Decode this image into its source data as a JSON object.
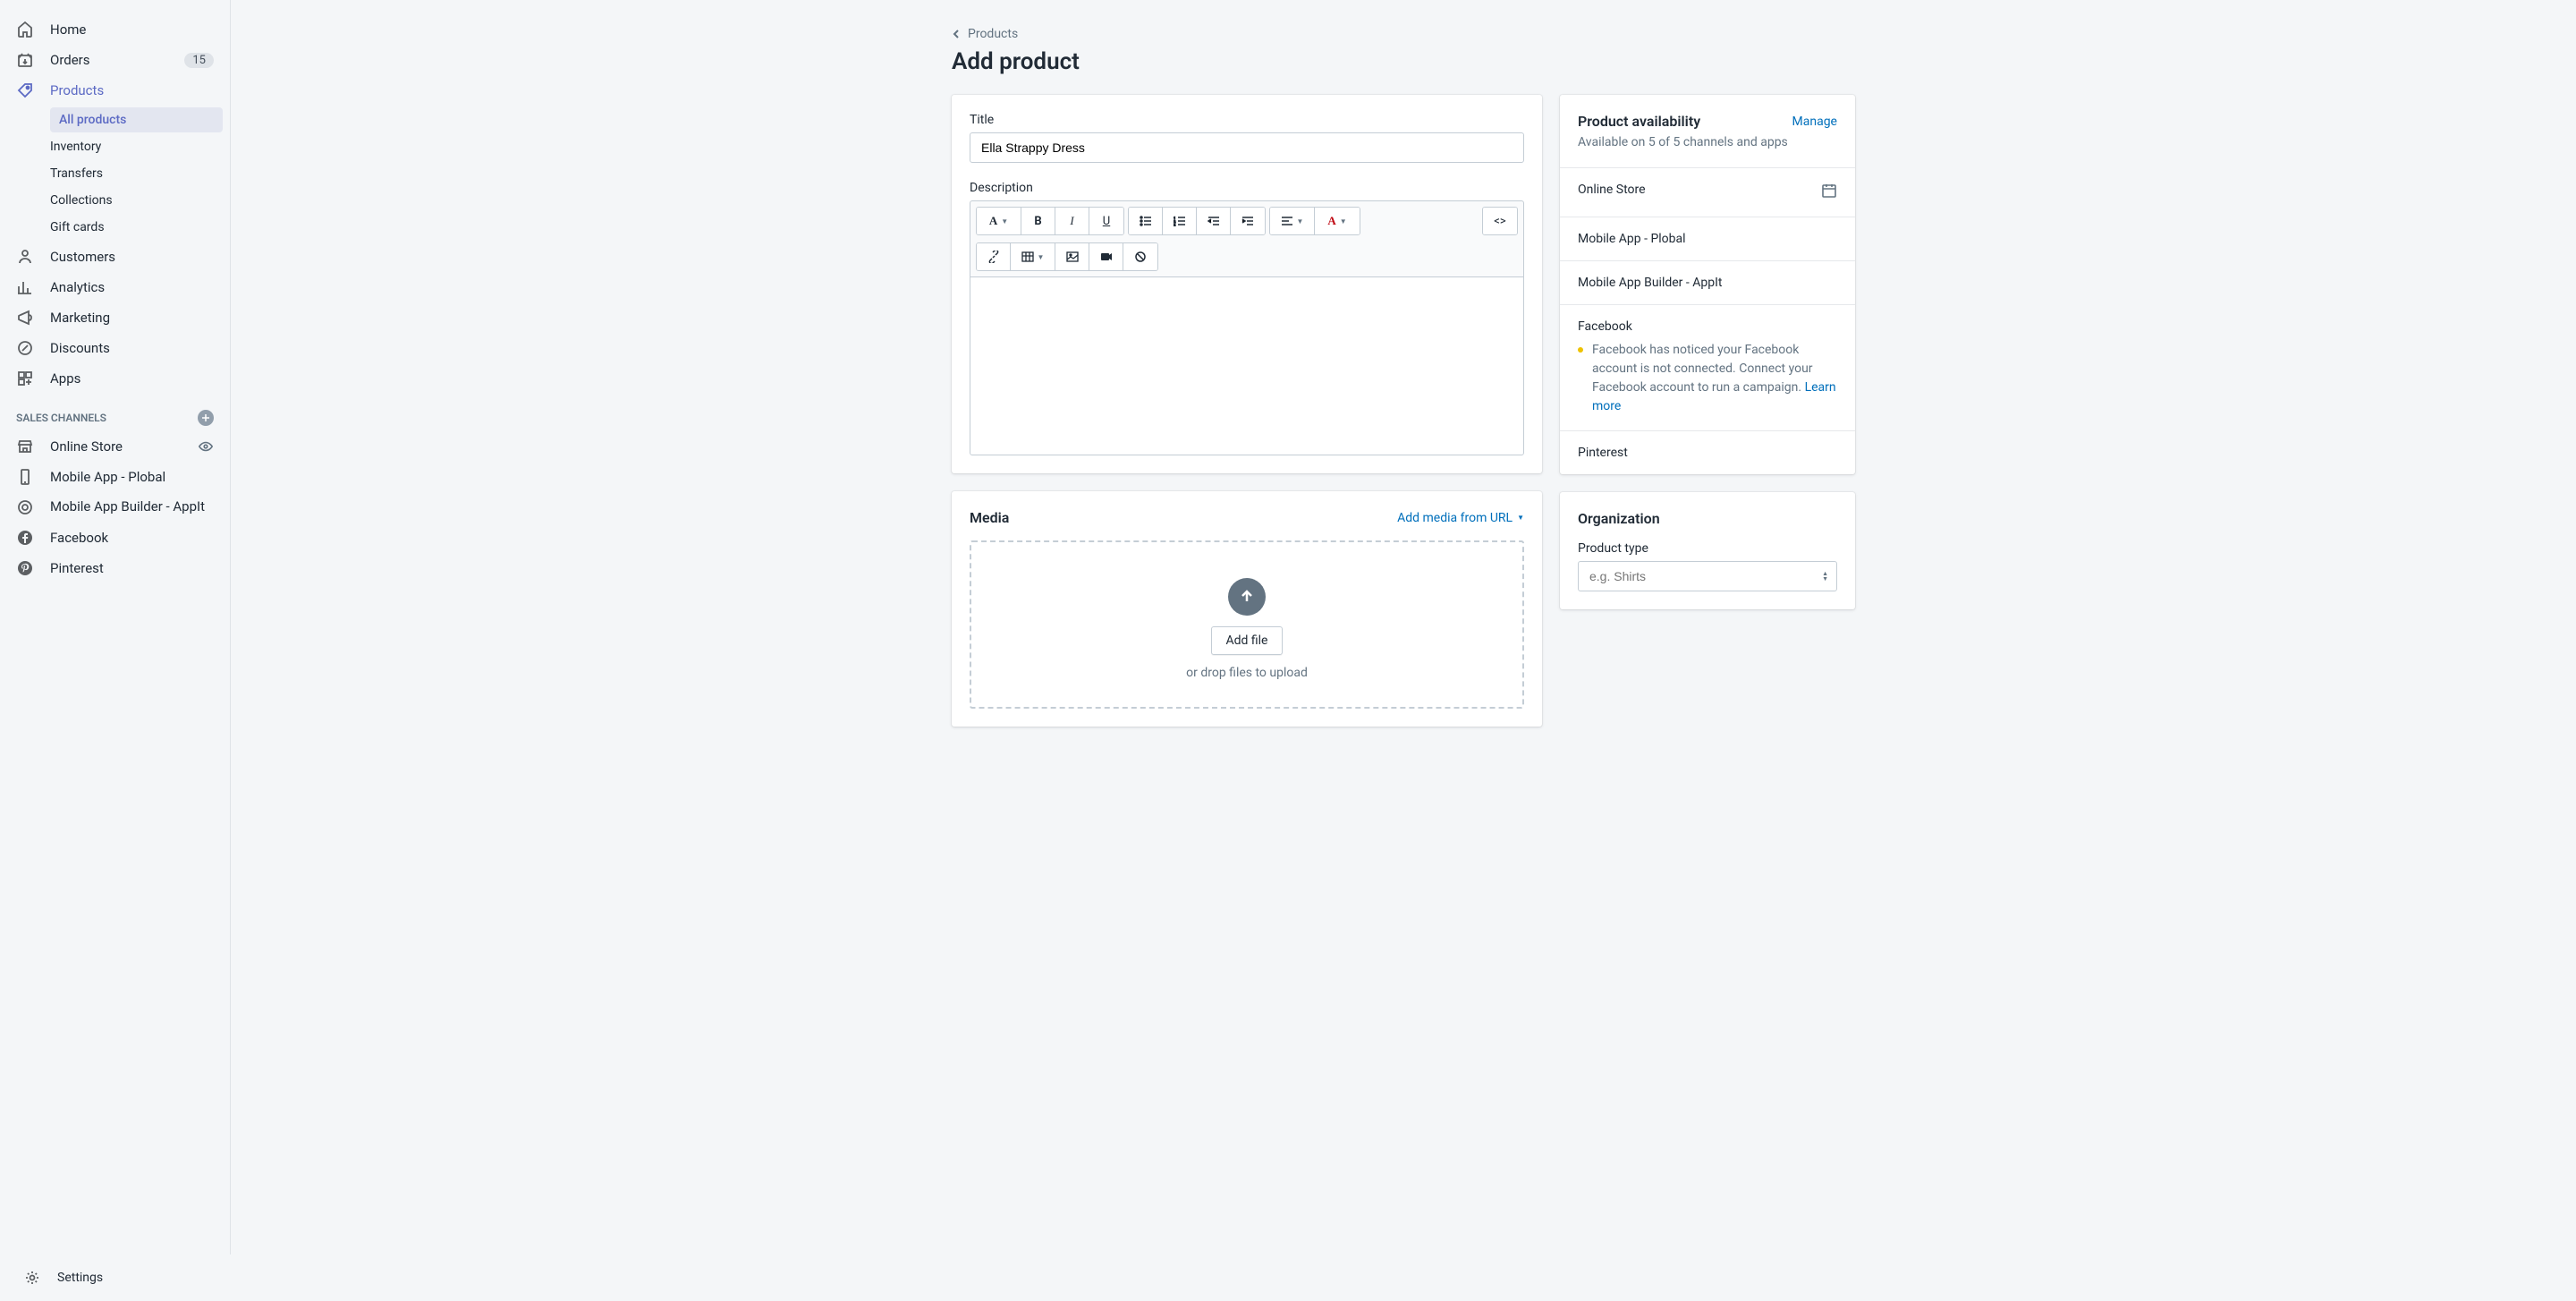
{
  "sidebar": {
    "nav": [
      {
        "label": "Home"
      },
      {
        "label": "Orders",
        "badge": "15"
      },
      {
        "label": "Products",
        "active": true,
        "sub": [
          {
            "label": "All products",
            "selected": true
          },
          {
            "label": "Inventory"
          },
          {
            "label": "Transfers"
          },
          {
            "label": "Collections"
          },
          {
            "label": "Gift cards"
          }
        ]
      },
      {
        "label": "Customers"
      },
      {
        "label": "Analytics"
      },
      {
        "label": "Marketing"
      },
      {
        "label": "Discounts"
      },
      {
        "label": "Apps"
      }
    ],
    "sales_channels_header": "SALES CHANNELS",
    "channels": [
      {
        "label": "Online Store",
        "eye": true
      },
      {
        "label": "Mobile App - Plobal"
      },
      {
        "label": "Mobile App Builder - AppIt"
      },
      {
        "label": "Facebook"
      },
      {
        "label": "Pinterest"
      }
    ],
    "settings": "Settings"
  },
  "breadcrumb": "Products",
  "page_title": "Add product",
  "title_section": {
    "label": "Title",
    "value": "Ella Strappy Dress"
  },
  "description_label": "Description",
  "media": {
    "title": "Media",
    "add_url": "Add media from URL",
    "add_file": "Add file",
    "drop_hint": "or drop files to upload"
  },
  "availability": {
    "title": "Product availability",
    "manage": "Manage",
    "subtitle": "Available on 5 of 5 channels and apps",
    "channels": [
      {
        "name": "Online Store",
        "calendar": true
      },
      {
        "name": "Mobile App - Plobal"
      },
      {
        "name": "Mobile App Builder - AppIt"
      },
      {
        "name": "Facebook",
        "note": "Facebook has noticed your Facebook account is not connected. Connect your Facebook account to run a campaign.",
        "learn_more": "Learn more"
      },
      {
        "name": "Pinterest"
      }
    ]
  },
  "organization": {
    "title": "Organization",
    "type_label": "Product type",
    "type_placeholder": "e.g. Shirts"
  }
}
